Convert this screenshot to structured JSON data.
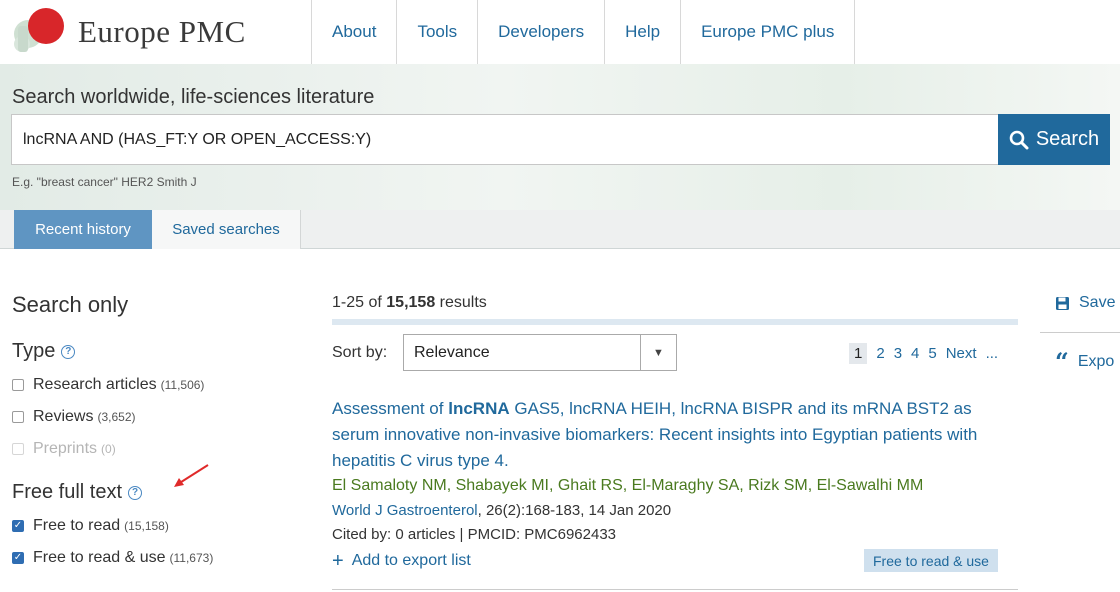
{
  "header": {
    "logo_text": "Europe PMC",
    "nav": [
      "About",
      "Tools",
      "Developers",
      "Help",
      "Europe PMC plus"
    ]
  },
  "search": {
    "title": "Search worldwide, life-sciences literature",
    "query": "lncRNA AND (HAS_FT:Y OR OPEN_ACCESS:Y)",
    "button_label": "Search",
    "hint": "E.g. \"breast cancer\" HER2 Smith J"
  },
  "tabs": {
    "active": "Recent history",
    "inactive": "Saved searches"
  },
  "sidebar": {
    "title": "Search only",
    "type_heading": "Type",
    "type_facets": [
      {
        "label": "Research articles",
        "count": "(11,506)",
        "checked": false,
        "disabled": false
      },
      {
        "label": "Reviews",
        "count": "(3,652)",
        "checked": false,
        "disabled": false
      },
      {
        "label": "Preprints",
        "count": "(0)",
        "checked": false,
        "disabled": true
      }
    ],
    "fulltext_heading": "Free full text",
    "fulltext_facets": [
      {
        "label": "Free to read",
        "count": "(15,158)",
        "checked": true
      },
      {
        "label": "Free to read & use",
        "count": "(11,673)",
        "checked": true
      }
    ]
  },
  "results": {
    "range": "1-25",
    "of_text": "of",
    "total": "15,158",
    "results_word": "results",
    "sort_label": "Sort by:",
    "sort_value": "Relevance",
    "pages": [
      "1",
      "2",
      "3",
      "4",
      "5"
    ],
    "current_page": "1",
    "next_label": "Next",
    "ellipsis": "...",
    "item": {
      "title_highlight": "lncRNA",
      "title_prefix": "Assessment of",
      "title_rest": "GAS5, lncRNA HEIH, lncRNA BISPR and its mRNA BST2 as serum innovative non-invasive biomarkers: Recent insights into Egyptian patients with hepatitis C virus type 4.",
      "authors": "El Samaloty NM, Shabayek MI, Ghait RS, El-Maraghy SA, Rizk SM, El-Sawalhi MM",
      "journal": "World J Gastroenterol",
      "citation": ", 26(2):168-183, 14 Jan 2020",
      "cited": "Cited by: 0 articles | PMCID: PMC6962433",
      "export_label": "Add to export list",
      "badge": "Free to read & use"
    }
  },
  "right_panel": {
    "save_label": "Save",
    "export_label": "Expo"
  },
  "colors": {
    "link": "#20699c",
    "search_button": "#20699c",
    "active_tab": "#5f95c2",
    "author_green": "#4a7a1f",
    "badge_bg": "#cfe0ee"
  }
}
